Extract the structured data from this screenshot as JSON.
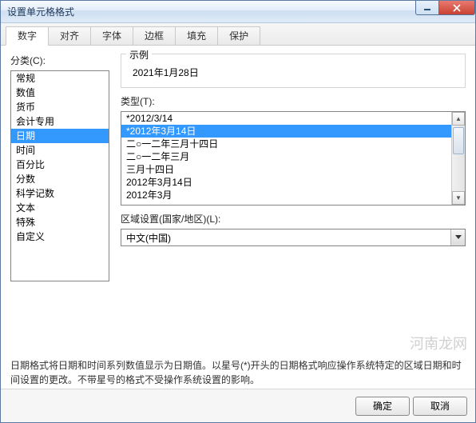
{
  "window": {
    "title": "设置单元格格式"
  },
  "tabs": {
    "items": [
      {
        "label": "数字"
      },
      {
        "label": "对齐"
      },
      {
        "label": "字体"
      },
      {
        "label": "边框"
      },
      {
        "label": "填充"
      },
      {
        "label": "保护"
      }
    ],
    "active_index": 0
  },
  "category": {
    "label": "分类(C):",
    "selected_index": 4,
    "items": [
      "常规",
      "数值",
      "货币",
      "会计专用",
      "日期",
      "时间",
      "百分比",
      "分数",
      "科学记数",
      "文本",
      "特殊",
      "自定义"
    ]
  },
  "sample": {
    "legend": "示例",
    "value": "2021年1月28日"
  },
  "type": {
    "label": "类型(T):",
    "selected_index": 1,
    "items": [
      "*2012/3/14",
      "*2012年3月14日",
      "二○一二年三月十四日",
      "二○一二年三月",
      "三月十四日",
      "2012年3月14日",
      "2012年3月"
    ]
  },
  "locale": {
    "label": "区域设置(国家/地区)(L):",
    "value": "中文(中国)"
  },
  "description": "日期格式将日期和时间系列数值显示为日期值。以星号(*)开头的日期格式响应操作系统特定的区域日期和时间设置的更改。不带星号的格式不受操作系统设置的影响。",
  "buttons": {
    "ok": "确定",
    "cancel": "取消"
  },
  "watermark": "河南龙网"
}
